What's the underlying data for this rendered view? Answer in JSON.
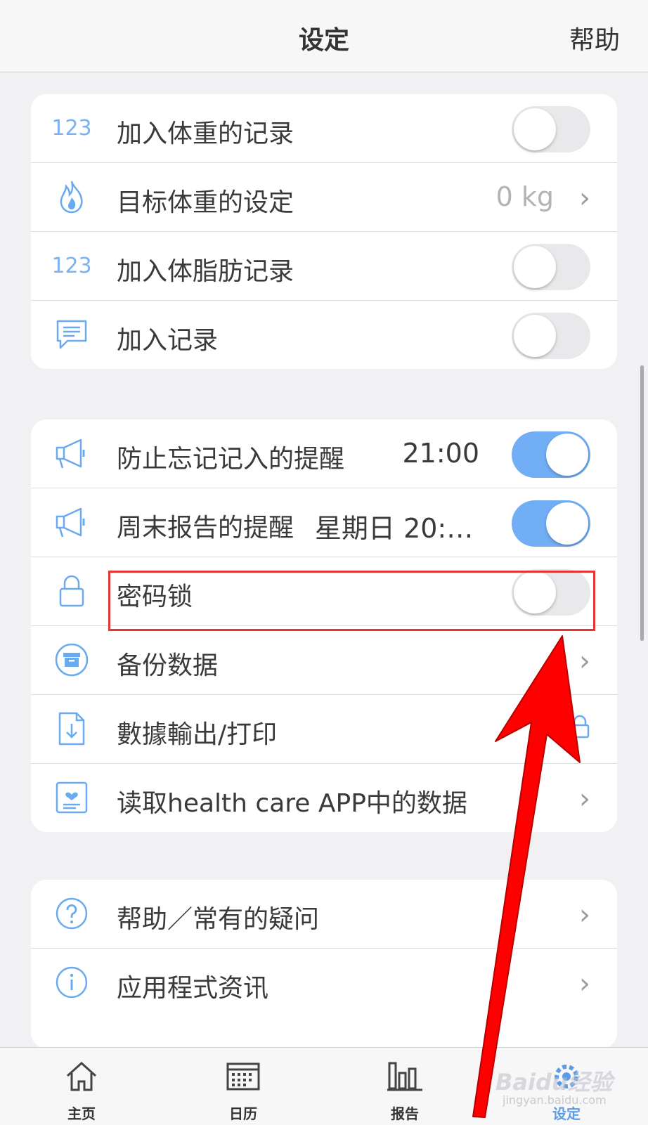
{
  "header": {
    "title": "设定",
    "help": "帮助"
  },
  "card1": {
    "rows": [
      {
        "icon_text": "123",
        "label": "加入体重的记录",
        "toggle": "off"
      },
      {
        "icon": "flame-icon",
        "label": "目标体重的设定",
        "value": "0 kg"
      },
      {
        "icon_text": "123",
        "label": "加入体脂肪记录",
        "toggle": "off"
      },
      {
        "icon": "chat-bubble-icon",
        "label": "加入记录",
        "toggle": "off"
      }
    ]
  },
  "card2": {
    "rows": [
      {
        "icon": "megaphone-icon",
        "label": "防止忘记记入的提醒",
        "time": "21:00",
        "toggle": "on"
      },
      {
        "icon": "megaphone-icon",
        "label": "周末报告的提醒",
        "time": "星期日 20:…",
        "toggle": "on"
      },
      {
        "icon": "lock-icon",
        "label": "密码锁",
        "toggle": "off"
      },
      {
        "icon": "archive-box-icon",
        "label": "备份数据"
      },
      {
        "icon": "document-download-icon",
        "label": "數據輸出/打印"
      },
      {
        "icon": "health-card-icon",
        "label": "读取health care APP中的数据"
      }
    ]
  },
  "card3": {
    "rows": [
      {
        "icon": "help-circle-icon",
        "label": "帮助／常有的疑问"
      },
      {
        "icon": "info-circle-icon",
        "label": "应用程式资讯"
      }
    ]
  },
  "tabbar": {
    "tabs": [
      {
        "label": "主页",
        "icon": "home-icon"
      },
      {
        "label": "日历",
        "icon": "calendar-icon"
      },
      {
        "label": "报告",
        "icon": "bar-chart-icon"
      },
      {
        "label": "设定",
        "icon": "gear-icon",
        "active": true
      }
    ]
  },
  "watermark": {
    "text": "Baidu经验",
    "sub": "jingyan.baidu.com"
  },
  "colors": {
    "accent": "#72aef5",
    "highlight": "#e23636",
    "arrow": "#ff0000"
  }
}
